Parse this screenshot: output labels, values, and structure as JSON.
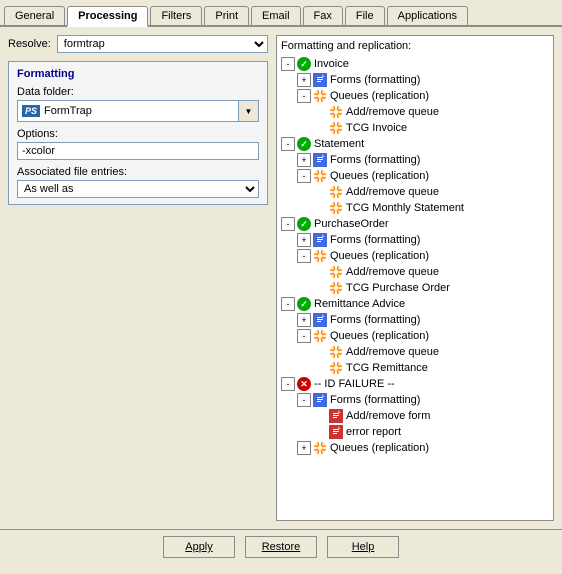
{
  "tabs": [
    {
      "label": "General",
      "active": false
    },
    {
      "label": "Processing",
      "active": true
    },
    {
      "label": "Filters",
      "active": false
    },
    {
      "label": "Print",
      "active": false
    },
    {
      "label": "Email",
      "active": false
    },
    {
      "label": "Fax",
      "active": false
    },
    {
      "label": "File",
      "active": false
    },
    {
      "label": "Applications",
      "active": false
    }
  ],
  "left": {
    "resolve_label": "Resolve:",
    "resolve_value": "formtrap",
    "formatting_title": "Formatting",
    "data_folder_label": "Data folder:",
    "data_folder_ps": "PS",
    "data_folder_value": "FormTrap",
    "options_label": "Options:",
    "options_value": "-xcolor",
    "assoc_label": "Associated file entries:",
    "assoc_value": "As well as"
  },
  "right": {
    "title": "Formatting and replication:",
    "tree": [
      {
        "level": 1,
        "icon": "green-check",
        "expand": "-",
        "label": "Invoice"
      },
      {
        "level": 2,
        "icon": "form-blue",
        "expand": "+",
        "label": "Forms (formatting)"
      },
      {
        "level": 2,
        "icon": "gear-orange",
        "expand": "-",
        "label": "Queues (replication)"
      },
      {
        "level": 3,
        "icon": "gear-orange",
        "expand": null,
        "label": "Add/remove queue"
      },
      {
        "level": 3,
        "icon": "gear-orange",
        "expand": null,
        "label": "TCG Invoice"
      },
      {
        "level": 1,
        "icon": "green-check",
        "expand": "-",
        "label": "Statement"
      },
      {
        "level": 2,
        "icon": "form-blue",
        "expand": "+",
        "label": "Forms (formatting)"
      },
      {
        "level": 2,
        "icon": "gear-orange",
        "expand": "-",
        "label": "Queues (replication)"
      },
      {
        "level": 3,
        "icon": "gear-orange",
        "expand": null,
        "label": "Add/remove queue"
      },
      {
        "level": 3,
        "icon": "gear-orange",
        "expand": null,
        "label": "TCG Monthly Statement"
      },
      {
        "level": 1,
        "icon": "green-check",
        "expand": "-",
        "label": "PurchaseOrder"
      },
      {
        "level": 2,
        "icon": "form-blue",
        "expand": "+",
        "label": "Forms (formatting)"
      },
      {
        "level": 2,
        "icon": "gear-orange",
        "expand": "-",
        "label": "Queues (replication)"
      },
      {
        "level": 3,
        "icon": "gear-orange",
        "expand": null,
        "label": "Add/remove queue"
      },
      {
        "level": 3,
        "icon": "gear-orange",
        "expand": null,
        "label": "TCG Purchase Order"
      },
      {
        "level": 1,
        "icon": "green-check",
        "expand": "-",
        "label": "Remittance Advice"
      },
      {
        "level": 2,
        "icon": "form-blue",
        "expand": "+",
        "label": "Forms (formatting)"
      },
      {
        "level": 2,
        "icon": "gear-orange",
        "expand": "-",
        "label": "Queues (replication)"
      },
      {
        "level": 3,
        "icon": "gear-orange",
        "expand": null,
        "label": "Add/remove queue"
      },
      {
        "level": 3,
        "icon": "gear-orange",
        "expand": null,
        "label": "TCG Remittance"
      },
      {
        "level": 1,
        "icon": "red-x",
        "expand": "-",
        "label": "-- ID FAILURE --"
      },
      {
        "level": 2,
        "icon": "form-blue",
        "expand": "-",
        "label": "Forms (formatting)"
      },
      {
        "level": 3,
        "icon": "form-red",
        "expand": null,
        "label": "Add/remove form"
      },
      {
        "level": 3,
        "icon": "form-red",
        "expand": null,
        "label": "error report"
      },
      {
        "level": 2,
        "icon": "gear-orange",
        "expand": "+",
        "label": "Queues (replication)"
      }
    ]
  },
  "buttons": {
    "apply": "Apply",
    "restore": "Restore",
    "help": "Help"
  }
}
